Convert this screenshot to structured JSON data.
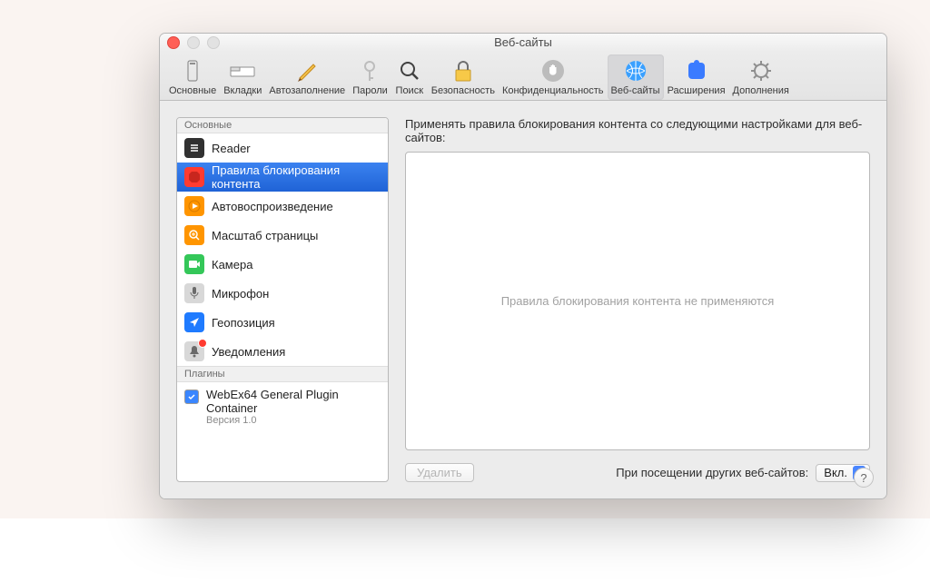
{
  "window": {
    "title": "Веб-сайты"
  },
  "toolbar": [
    {
      "label": "Основные"
    },
    {
      "label": "Вкладки"
    },
    {
      "label": "Автозаполнение"
    },
    {
      "label": "Пароли"
    },
    {
      "label": "Поиск"
    },
    {
      "label": "Безопасность"
    },
    {
      "label": "Конфиденциальность"
    },
    {
      "label": "Веб-сайты"
    },
    {
      "label": "Расширения"
    },
    {
      "label": "Дополнения"
    }
  ],
  "sidebar": {
    "section_general": "Основные",
    "items": [
      {
        "label": "Reader"
      },
      {
        "label": "Правила блокирования контента"
      },
      {
        "label": "Автовоспроизведение"
      },
      {
        "label": "Масштаб страницы"
      },
      {
        "label": "Камера"
      },
      {
        "label": "Микрофон"
      },
      {
        "label": "Геопозиция"
      },
      {
        "label": "Уведомления"
      }
    ],
    "section_plugins": "Плагины",
    "plugin": {
      "label": "WebEx64 General Plugin Container",
      "version": "Версия 1.0"
    }
  },
  "main": {
    "heading": "Применять правила блокирования контента со следующими настройками для веб-сайтов:",
    "empty": "Правила блокирования контента не применяются",
    "delete_btn": "Удалить",
    "visit_label": "При посещении других веб-сайтов:",
    "visit_value": "Вкл."
  }
}
